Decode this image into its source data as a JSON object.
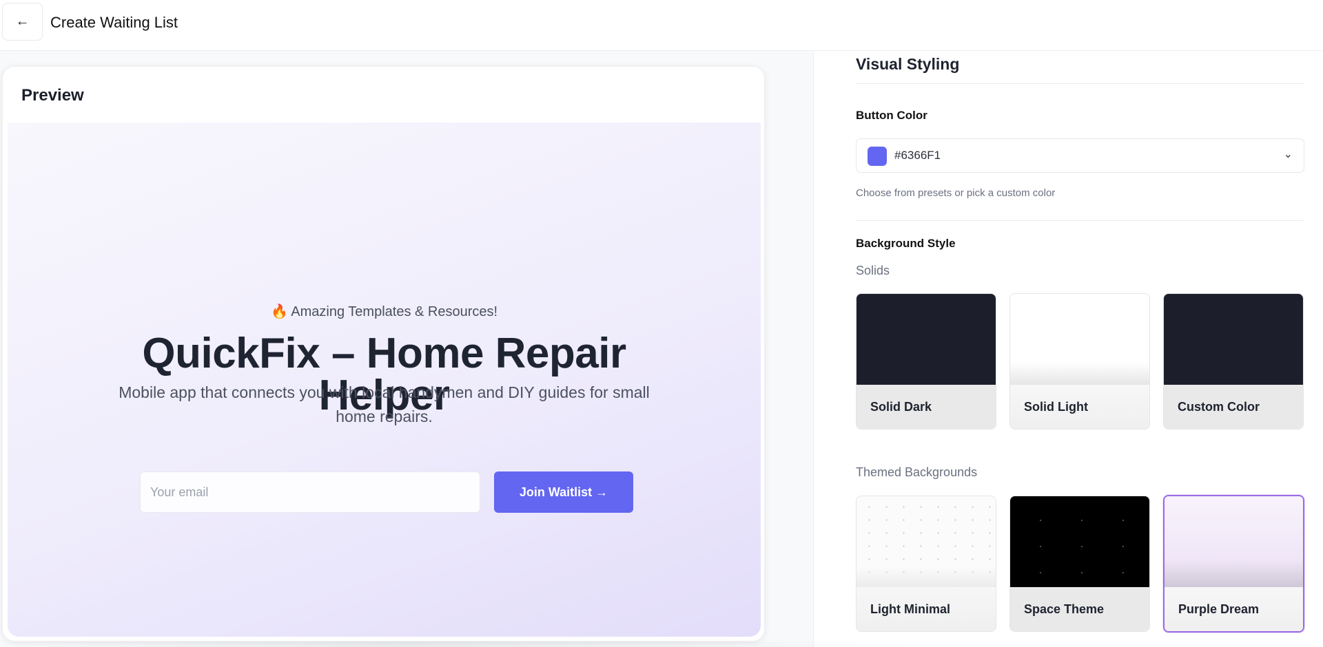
{
  "header": {
    "back_icon": "arrow-left-icon",
    "back_glyph": "←",
    "title": "Create Waiting List"
  },
  "preview": {
    "title": "Preview",
    "badge": "🔥 Amazing Templates & Resources!",
    "hero_title": "QuickFix – Home Repair Helper",
    "description": "Mobile app that connects you with local handymen and DIY guides for small home repairs.",
    "email_placeholder": "Your email",
    "join_label": "Join Waitlist →",
    "button_color": "#6366F1"
  },
  "settings": {
    "section_title": "Visual Styling",
    "button_color": {
      "label": "Button Color",
      "value": "#6366F1",
      "swatch_color": "#6366F1",
      "chevron_glyph": "⌄",
      "helper": "Choose from presets or pick a custom color"
    },
    "background_style": {
      "label": "Background Style",
      "solids_label": "Solids",
      "solids": [
        {
          "label": "Solid Dark",
          "selected": false
        },
        {
          "label": "Solid Light",
          "selected": false
        },
        {
          "label": "Custom Color",
          "selected": false
        }
      ],
      "themed_label": "Themed Backgrounds",
      "themed": [
        {
          "label": "Light Minimal",
          "selected": false
        },
        {
          "label": "Space Theme",
          "selected": false
        },
        {
          "label": "Purple Dream",
          "selected": true
        }
      ]
    }
  }
}
